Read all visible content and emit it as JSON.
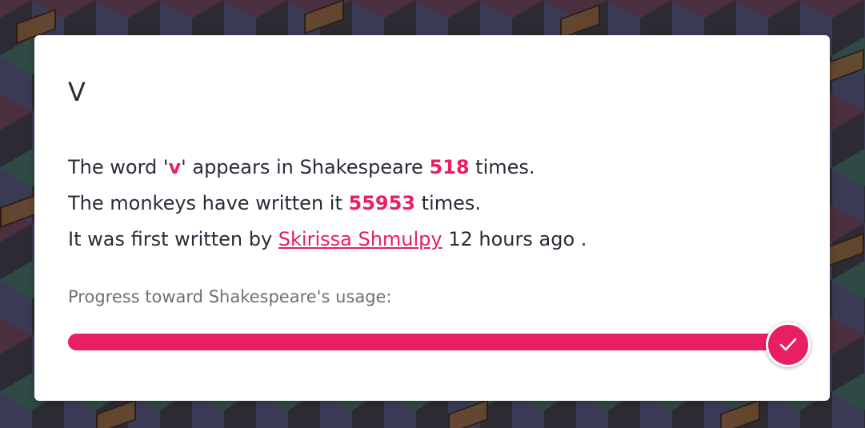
{
  "word": {
    "title": "V",
    "quoted": "v"
  },
  "stats": {
    "line1_prefix": "The word '",
    "line1_mid": "' appears in Shakespeare ",
    "shakespeare_count": "518",
    "line1_suffix": " times.",
    "line2_prefix": "The monkeys have written it ",
    "monkey_count": "55953",
    "line2_suffix": " times.",
    "line3_prefix": "It was first written by ",
    "first_author": "Skirissa Shmulpy",
    "line3_suffix": " 12 hours ago ."
  },
  "progress": {
    "label": "Progress toward Shakespeare's usage:",
    "fraction": 1.0,
    "complete_icon": "checkmark-icon"
  },
  "colors": {
    "accent": "#e91e63",
    "text": "#2b2b3a",
    "muted": "#6e6e78"
  }
}
